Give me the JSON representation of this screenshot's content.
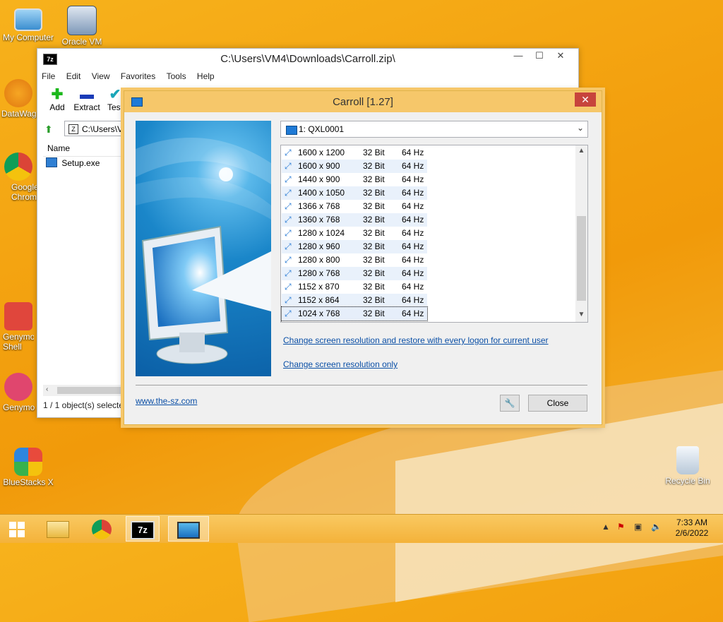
{
  "desktop": {
    "icons": [
      {
        "label": "My Computer"
      },
      {
        "label": "Oracle VM"
      },
      {
        "label": "DataWag"
      },
      {
        "label": "Google Chrom"
      },
      {
        "label": "Genymo Shell"
      },
      {
        "label": "Genymo"
      },
      {
        "label": "BlueStacks X"
      },
      {
        "label": "Recycle Bin"
      }
    ]
  },
  "sevenzip": {
    "title": "C:\\Users\\VM4\\Downloads\\Carroll.zip\\",
    "app_icon": "7z",
    "menu": [
      "File",
      "Edit",
      "View",
      "Favorites",
      "Tools",
      "Help"
    ],
    "toolbar": {
      "add": "Add",
      "extract": "Extract",
      "test": "Test"
    },
    "address": "C:\\Users\\VM",
    "column_name": "Name",
    "files": [
      "Setup.exe"
    ],
    "status": "1 / 1 object(s) selecte"
  },
  "dialog": {
    "title": "Carroll [1.27]",
    "display_select": "1: QXL0001",
    "resolutions": [
      {
        "res": "1600 x 1200",
        "bits": "32 Bit",
        "hz": "64 Hz"
      },
      {
        "res": "1600 x 900",
        "bits": "32 Bit",
        "hz": "64 Hz"
      },
      {
        "res": "1440 x 900",
        "bits": "32 Bit",
        "hz": "64 Hz"
      },
      {
        "res": "1400 x 1050",
        "bits": "32 Bit",
        "hz": "64 Hz"
      },
      {
        "res": "1366 x 768",
        "bits": "32 Bit",
        "hz": "64 Hz"
      },
      {
        "res": "1360 x 768",
        "bits": "32 Bit",
        "hz": "64 Hz"
      },
      {
        "res": "1280 x 1024",
        "bits": "32 Bit",
        "hz": "64 Hz"
      },
      {
        "res": "1280 x 960",
        "bits": "32 Bit",
        "hz": "64 Hz"
      },
      {
        "res": "1280 x 800",
        "bits": "32 Bit",
        "hz": "64 Hz"
      },
      {
        "res": "1280 x 768",
        "bits": "32 Bit",
        "hz": "64 Hz"
      },
      {
        "res": "1152 x 870",
        "bits": "32 Bit",
        "hz": "64 Hz"
      },
      {
        "res": "1152 x 864",
        "bits": "32 Bit",
        "hz": "64 Hz"
      },
      {
        "res": "1024 x 768",
        "bits": "32 Bit",
        "hz": "64 Hz"
      }
    ],
    "selected_index": 12,
    "link_restore": "Change screen resolution and restore with every logon for current user",
    "link_only": "Change screen resolution only",
    "website": "www.the-sz.com",
    "close_label": "Close"
  },
  "taskbar": {
    "clock_time": "7:33 AM",
    "clock_date": "2/6/2022",
    "items": [
      "start-icon",
      "file-explorer-icon",
      "chrome-icon",
      "7zip-icon",
      "carroll-icon"
    ]
  },
  "colors": {
    "accent": "#f6c76a",
    "link": "#0a4fa6",
    "close_red": "#c7443c"
  }
}
